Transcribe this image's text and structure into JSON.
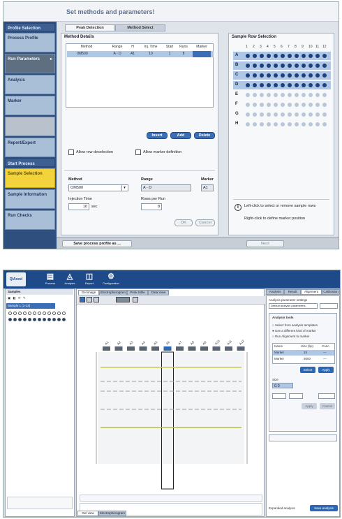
{
  "s1": {
    "header_title": "Set methods and parameters!",
    "sidebar": [
      {
        "label": "Profile Selection",
        "style": "hd"
      },
      {
        "label": "Process Profile",
        "style": ""
      },
      {
        "label": "Run Parameters",
        "style": "dark"
      },
      {
        "label": "Analysis",
        "style": ""
      },
      {
        "label": "Marker",
        "style": ""
      },
      {
        "label": "",
        "style": "gray"
      },
      {
        "label": "Report/Export",
        "style": ""
      },
      {
        "label": "Start Process",
        "style": "hd"
      },
      {
        "label": "Sample Selection",
        "style": "act"
      },
      {
        "label": "Sample Information",
        "style": ""
      },
      {
        "label": "Run Checks",
        "style": ""
      }
    ],
    "tabs": [
      "Peak Detection",
      "Method Select"
    ],
    "method_panel": {
      "title": "Method Details",
      "columns": [
        "Method",
        "Range",
        "H",
        "Inj. Time",
        "Start",
        "Runs",
        "Marker"
      ],
      "rows": [
        [
          "0M500",
          "A - D",
          "A1",
          "10",
          "1",
          "8",
          ""
        ]
      ],
      "buttons": [
        "Insert",
        "Add",
        "Delete"
      ],
      "checks": [
        "Allow row deselection",
        "Allow marker definition"
      ]
    },
    "form": {
      "method_label": "Method",
      "method_value": "OM500",
      "range_label": "Range",
      "range_value": "A - D",
      "marker_label": "Marker",
      "marker_value": "A1",
      "inj_label": "Injection Time",
      "inj_value": "10",
      "inj_unit": "sec",
      "rows_label": "Rows per Run",
      "rows_value": "8",
      "ok": "OK",
      "cancel": "Cancel"
    },
    "sample_panel": {
      "title": "Sample Row Selection",
      "col_headers": [
        "1",
        "2",
        "3",
        "4",
        "5",
        "6",
        "7",
        "8",
        "9",
        "10",
        "11",
        "12"
      ],
      "row_labels": [
        "A",
        "B",
        "C",
        "D",
        "E",
        "F",
        "G",
        "H"
      ],
      "selected_rows": 4,
      "note1": "Left-click to select or remove sample rows",
      "note2": "Right-click to define marker position"
    },
    "footer": {
      "save": "Save process profile as ...",
      "next": "Next"
    }
  },
  "s2": {
    "logo": "QIAxcel",
    "toolbar": [
      {
        "glyph": "▤",
        "label": "Process"
      },
      {
        "glyph": "◬",
        "label": "Analysis"
      },
      {
        "glyph": "◫",
        "label": "Report"
      },
      {
        "glyph": "⚙",
        "label": "Configuration"
      }
    ],
    "left_header": "Samples",
    "left_item": "Sample 1 (1-12)",
    "center_tabs": [
      "Gel image",
      "Electropherogram",
      "Peak table",
      "Data View"
    ],
    "right_tabs": [
      "Analysis",
      "Result",
      "Alignment",
      "Calibration"
    ],
    "lane_labels": [
      "A1",
      "A2",
      "A3",
      "A4",
      "A5",
      "A6",
      "A7",
      "A8",
      "A9",
      "A10",
      "A11",
      "A12"
    ],
    "right_panel": {
      "param_label": "Analysis parameter settings",
      "param_value": "Default analysis parameters",
      "group_title": "Analysis tools",
      "options": [
        "Select from analysis templates",
        "Use a different kind of marker",
        "Run Alignment to marker"
      ],
      "table_headers": [
        "Name",
        "Size (bp)",
        "Conc."
      ],
      "table_rows": [
        [
          "Marker",
          "15",
          "—"
        ],
        [
          "Marker",
          "3000",
          "—"
        ]
      ],
      "btn1": "Select",
      "btn2": "Apply",
      "size_label": "Size",
      "size_value": "0.0",
      "apply": "Apply",
      "cancel": "Cancel"
    },
    "bottom_buttons": [
      "Gel view",
      "Electropherogram"
    ],
    "bottom_right_label": "Expanded analysis",
    "bottom_right_btn": "Save analysis"
  }
}
